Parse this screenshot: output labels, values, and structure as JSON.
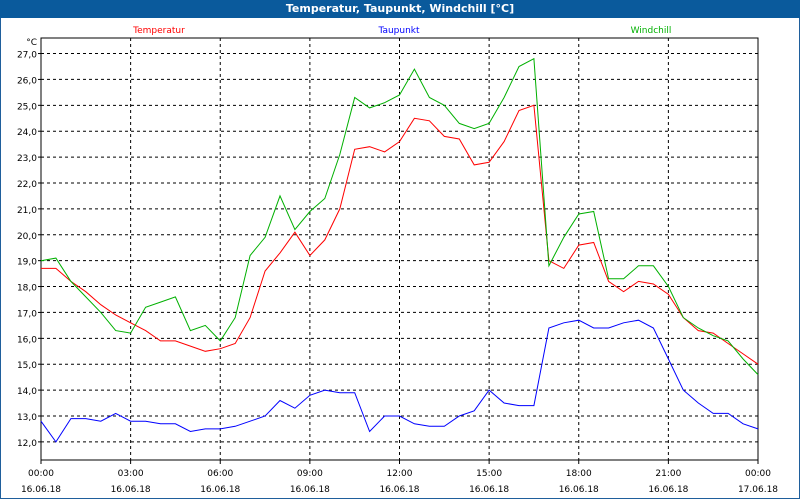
{
  "window": {
    "title": "Temperatur, Taupunkt, Windchill [°C]"
  },
  "chart_data": {
    "type": "line",
    "title": "Temperatur, Taupunkt, Windchill [°C]",
    "ylabel": "°C",
    "ylim": [
      11.3,
      27.6
    ],
    "xlim": [
      0,
      24
    ],
    "grid": true,
    "legend_placement": "top",
    "yticks": [
      "12,0",
      "13,0",
      "14,0",
      "15,0",
      "16,0",
      "17,0",
      "18,0",
      "19,0",
      "20,0",
      "21,0",
      "22,0",
      "23,0",
      "24,0",
      "25,0",
      "26,0",
      "27,0"
    ],
    "xticks": [
      {
        "time": "00:00",
        "date": "16.06.18"
      },
      {
        "time": "03:00",
        "date": "16.06.18"
      },
      {
        "time": "06:00",
        "date": "16.06.18"
      },
      {
        "time": "09:00",
        "date": "16.06.18"
      },
      {
        "time": "12:00",
        "date": "16.06.18"
      },
      {
        "time": "15:00",
        "date": "16.06.18"
      },
      {
        "time": "18:00",
        "date": "16.06.18"
      },
      {
        "time": "21:00",
        "date": "16.06.18"
      },
      {
        "time": "00:00",
        "date": "17.06.18"
      }
    ],
    "series": [
      {
        "name": "Temperatur",
        "color": "#ff0000",
        "x": [
          0,
          0.5,
          1,
          1.5,
          2,
          2.5,
          3,
          3.5,
          4,
          4.5,
          5,
          5.5,
          6,
          6.5,
          7,
          7.5,
          8,
          8.5,
          9,
          9.5,
          10,
          10.5,
          11,
          11.5,
          12,
          12.5,
          13,
          13.5,
          14,
          14.5,
          15,
          15.5,
          16,
          16.5,
          17,
          17.5,
          18,
          18.5,
          19,
          19.5,
          20,
          20.5,
          21,
          21.5,
          22,
          22.5,
          23,
          23.5,
          24
        ],
        "y": [
          18.7,
          18.7,
          18.2,
          17.8,
          17.3,
          16.9,
          16.6,
          16.3,
          15.9,
          15.9,
          15.7,
          15.5,
          15.6,
          15.8,
          16.8,
          18.6,
          19.3,
          20.1,
          19.2,
          19.8,
          21.0,
          23.3,
          23.4,
          23.2,
          23.6,
          24.5,
          24.4,
          23.8,
          23.7,
          22.7,
          22.8,
          23.6,
          24.8,
          25.0,
          19.0,
          18.7,
          19.6,
          19.7,
          18.2,
          17.8,
          18.2,
          18.1,
          17.7,
          16.8,
          16.3,
          16.2,
          15.8,
          15.4,
          15.0
        ]
      },
      {
        "name": "Taupunkt",
        "color": "#0000ff",
        "x": [
          0,
          0.5,
          1,
          1.5,
          2,
          2.5,
          3,
          3.5,
          4,
          4.5,
          5,
          5.5,
          6,
          6.5,
          7,
          7.5,
          8,
          8.5,
          9,
          9.5,
          10,
          10.5,
          11,
          11.5,
          12,
          12.5,
          13,
          13.5,
          14,
          14.5,
          15,
          15.5,
          16,
          16.5,
          17,
          17.5,
          18,
          18.5,
          19,
          19.5,
          20,
          20.5,
          21,
          21.5,
          22,
          22.5,
          23,
          23.5,
          24
        ],
        "y": [
          12.8,
          12.0,
          12.9,
          12.9,
          12.8,
          13.1,
          12.8,
          12.8,
          12.7,
          12.7,
          12.4,
          12.5,
          12.5,
          12.6,
          12.8,
          13.0,
          13.6,
          13.3,
          13.8,
          14.0,
          13.9,
          13.9,
          12.4,
          13.0,
          13.0,
          12.7,
          12.6,
          12.6,
          13.0,
          13.2,
          14.0,
          13.5,
          13.4,
          13.4,
          16.4,
          16.6,
          16.7,
          16.4,
          16.4,
          16.6,
          16.7,
          16.4,
          15.2,
          14.0,
          13.5,
          13.1,
          13.1,
          12.7,
          12.5
        ]
      },
      {
        "name": "Windchill",
        "color": "#00b000",
        "x": [
          0,
          0.5,
          1,
          1.5,
          2,
          2.5,
          3,
          3.5,
          4,
          4.5,
          5,
          5.5,
          6,
          6.5,
          7,
          7.5,
          8,
          8.5,
          9,
          9.5,
          10,
          10.5,
          11,
          11.5,
          12,
          12.5,
          13,
          13.5,
          14,
          14.5,
          15,
          15.5,
          16,
          16.5,
          17,
          17.5,
          18,
          18.5,
          19,
          19.5,
          20,
          20.5,
          21,
          21.5,
          22,
          22.5,
          23,
          23.5,
          24
        ],
        "y": [
          19.0,
          19.1,
          18.2,
          17.6,
          17.0,
          16.3,
          16.2,
          17.2,
          17.4,
          17.6,
          16.3,
          16.5,
          15.9,
          16.8,
          19.2,
          19.9,
          21.5,
          20.2,
          20.9,
          21.4,
          23.1,
          25.3,
          24.9,
          25.1,
          25.4,
          26.4,
          25.3,
          25.0,
          24.3,
          24.1,
          24.3,
          25.3,
          26.5,
          26.8,
          18.8,
          19.9,
          20.8,
          20.9,
          18.3,
          18.3,
          18.8,
          18.8,
          18.0,
          16.8,
          16.4,
          16.1,
          15.9,
          15.2,
          14.6
        ]
      }
    ]
  }
}
